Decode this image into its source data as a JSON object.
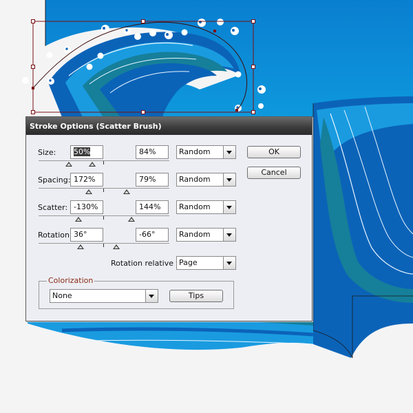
{
  "dialog": {
    "title": "Stroke Options (Scatter Brush)",
    "ok_label": "OK",
    "cancel_label": "Cancel",
    "rows": [
      {
        "label": "Size:",
        "min": "50%",
        "max": "84%",
        "mode": "Random"
      },
      {
        "label": "Spacing:",
        "min": "172%",
        "max": "79%",
        "mode": "Random"
      },
      {
        "label": "Scatter:",
        "min": "-130%",
        "max": "144%",
        "mode": "Random"
      },
      {
        "label": "Rotation:",
        "min": "36°",
        "max": "-66°",
        "mode": "Random"
      }
    ],
    "rotation_relative_label": "Rotation relative to:",
    "rotation_relative_value": "Page",
    "colorization": {
      "label": "Colorization",
      "method": "None",
      "tips_label": "Tips"
    }
  },
  "colors": {
    "sky_top": "#0a7fd0",
    "sky_bottom": "#13bff0",
    "wave_dark": "#0b63b8",
    "wave_teal": "#167f9a",
    "wave_mid": "#1a9be0",
    "selection": "#7a0f12",
    "dialog_bg": "#eceef3"
  }
}
